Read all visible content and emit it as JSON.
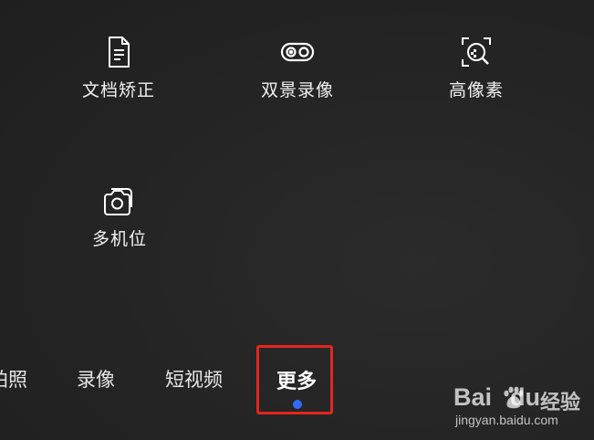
{
  "modes": [
    {
      "label": "文档矫正",
      "icon": "document-icon"
    },
    {
      "label": "双景录像",
      "icon": "dual-view-icon"
    },
    {
      "label": "高像素",
      "icon": "high-pixel-icon"
    },
    {
      "label": "多机位",
      "icon": "multi-camera-icon"
    }
  ],
  "tabs": [
    {
      "label": "拍照"
    },
    {
      "label": "录像"
    },
    {
      "label": "短视频"
    },
    {
      "label": "更多"
    }
  ],
  "active_tab": "更多",
  "colors": {
    "indicator": "#2f6bff",
    "highlight_box": "#e3261e"
  },
  "watermark": {
    "brand": "Bai",
    "brand_tail": "du",
    "cn": "经验",
    "url": "jingyan.baidu.com"
  }
}
